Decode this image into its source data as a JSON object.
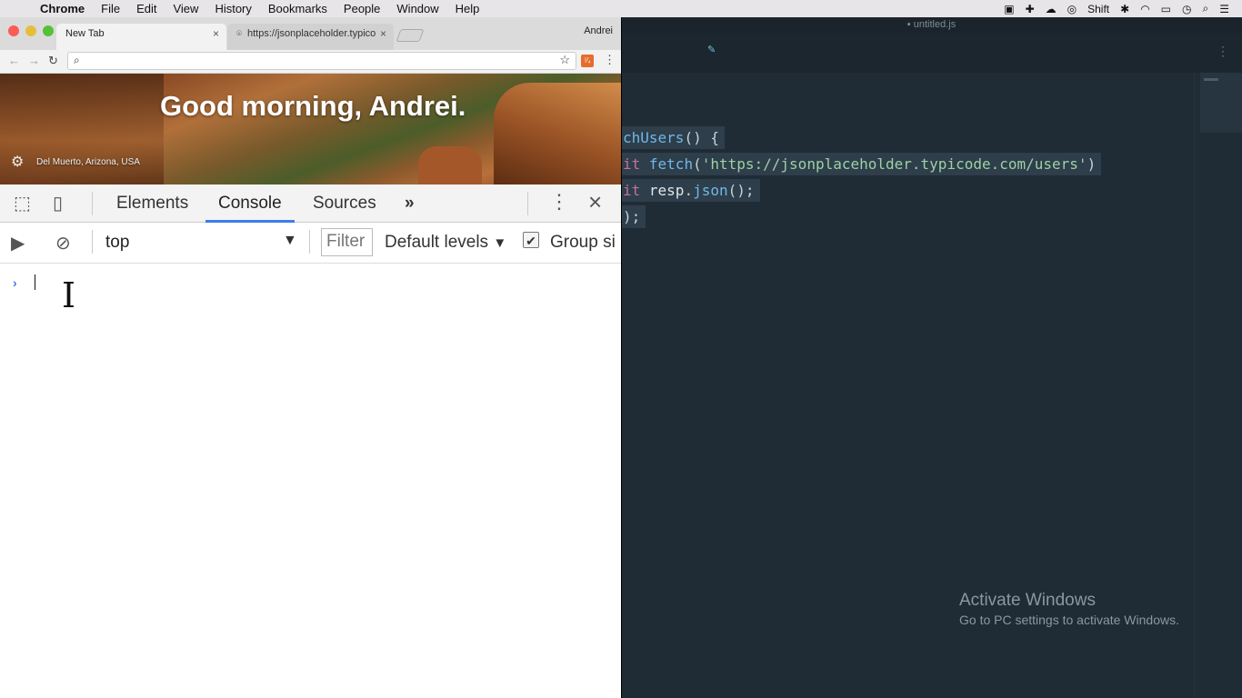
{
  "menubar": {
    "app_name": "Chrome",
    "items": [
      "File",
      "Edit",
      "View",
      "History",
      "Bookmarks",
      "People",
      "Window",
      "Help"
    ],
    "status_text": "Shift"
  },
  "chrome": {
    "tabs": [
      {
        "label": "New Tab",
        "active": true
      },
      {
        "label": "https://jsonplaceholder.typico",
        "active": false
      }
    ],
    "profile": "Andrei",
    "omnibox_value": "",
    "ntp": {
      "greeting": "Good morning, Andrei.",
      "location": "Del Muerto, Arizona, USA"
    }
  },
  "devtools": {
    "tabs": [
      "Elements",
      "Console",
      "Sources"
    ],
    "active_tab": "Console",
    "more_tabs_glyph": "»",
    "context": "top",
    "filter_placeholder": "Filter",
    "levels": "Default levels",
    "group_similar": "Group si",
    "group_similar_checked": true,
    "prompt_glyph": "›"
  },
  "editor": {
    "filename": "untitled.js",
    "code": {
      "line1_fn": "chUsers",
      "line1_rest": "() {",
      "line2_kw": "it",
      "line2_fn": "fetch",
      "line2_str": "'https://jsonplaceholder.typicode.com/users'",
      "line3_kw": "it",
      "line3_var": "resp",
      "line3_fn": "json",
      "line4": ");"
    },
    "watermark_title": "Activate Windows",
    "watermark_sub": "Go to PC settings to activate Windows."
  },
  "colors": {
    "accent_blue": "#3c7de6",
    "editor_bg": "#1f2b35",
    "keyword": "#c2729c",
    "function": "#6fb8e8",
    "string": "#9ed0a5"
  }
}
